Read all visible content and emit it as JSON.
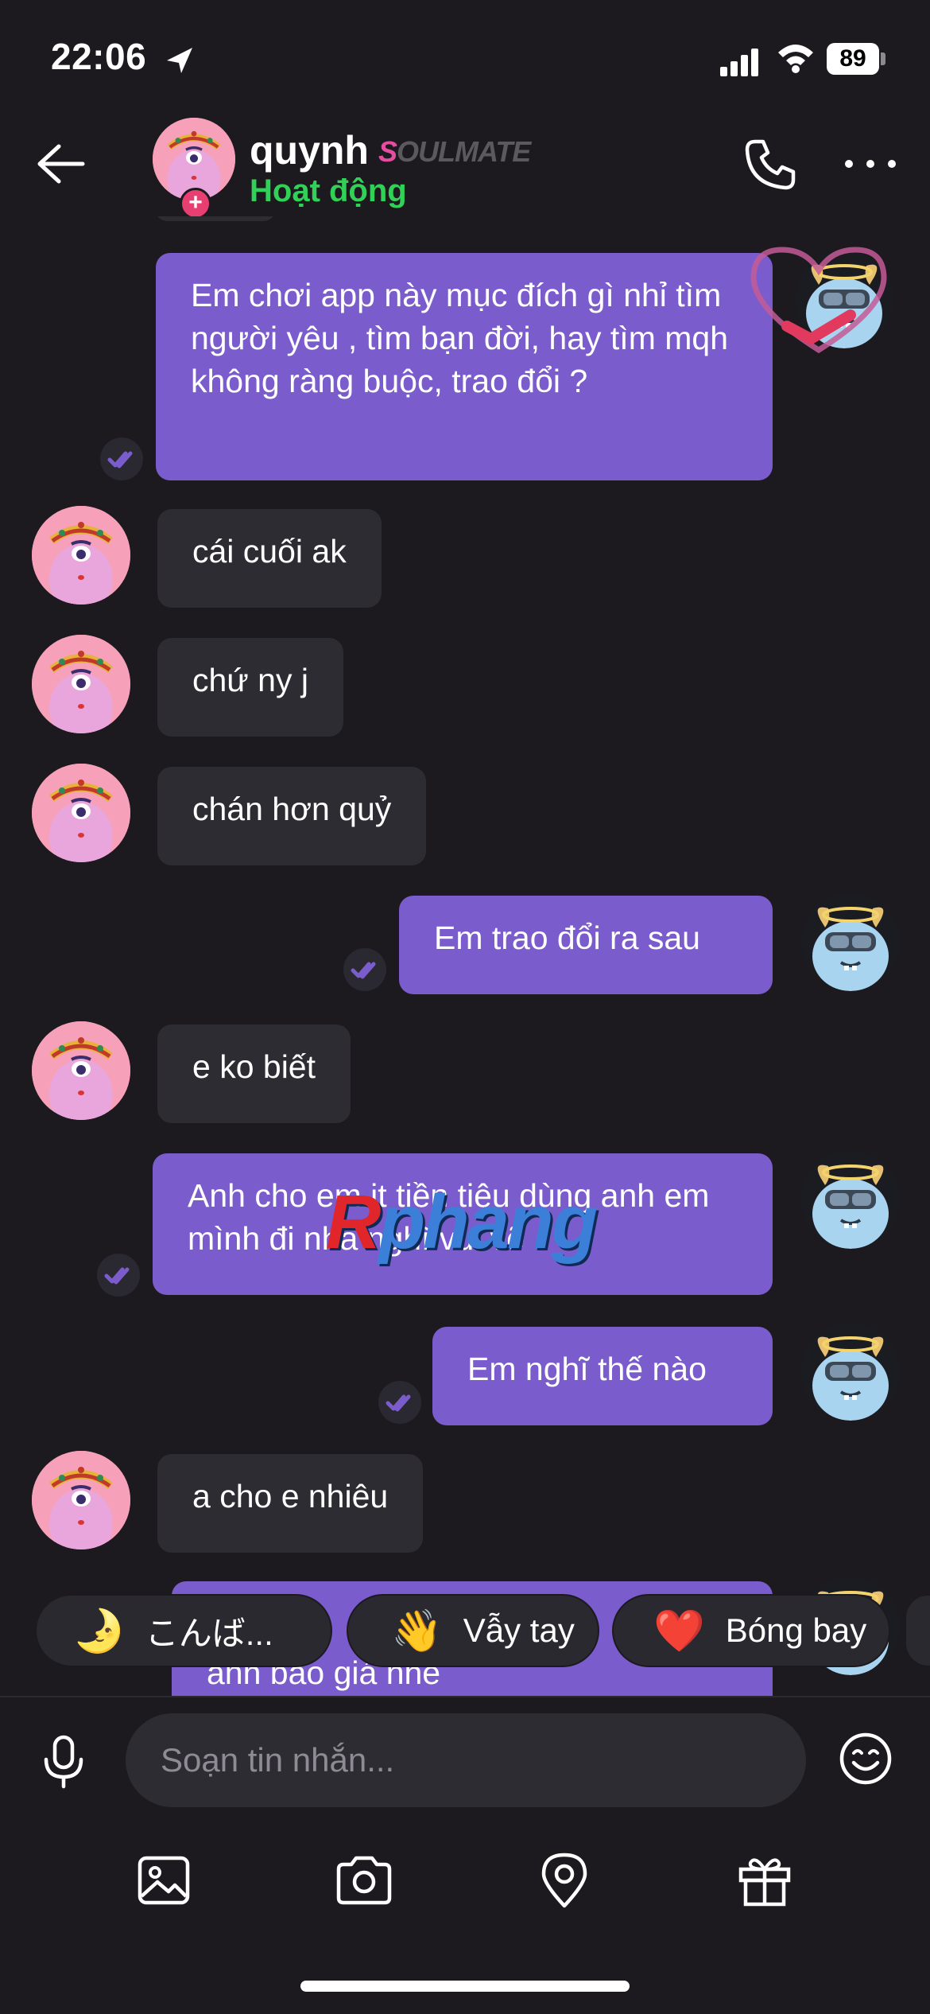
{
  "status_bar": {
    "time": "22:06",
    "battery": "89"
  },
  "header": {
    "name": "quynh",
    "badge": "SOULMATE",
    "status": "Hoạt động"
  },
  "messages": [
    {
      "side": "out",
      "text": "Em chơi app này mục đích gì nhỉ tìm người yêu , tìm bạn đời, hay tìm mqh không ràng buộc, trao đổi ?"
    },
    {
      "side": "in",
      "text": "cái cuối ak"
    },
    {
      "side": "in",
      "text": "chứ ny j"
    },
    {
      "side": "in",
      "text": "chán hơn quỷ"
    },
    {
      "side": "out",
      "text": "Em trao đổi ra sau"
    },
    {
      "side": "in",
      "text": "e ko biết"
    },
    {
      "side": "out",
      "text": "Anh cho em it tiền tiêu dùng anh em mình đi nhà nghĩ vui vẽ"
    },
    {
      "side": "out",
      "text": "Em nghĩ thế nào"
    },
    {
      "side": "in",
      "text": "a cho e nhiêu"
    },
    {
      "side": "out",
      "text": "anh báo giá nhé"
    }
  ],
  "quick_reactions": [
    {
      "emoji": "🌛",
      "label": "こんば..."
    },
    {
      "emoji": "👋",
      "label": "Vẫy tay"
    },
    {
      "emoji": "❤️",
      "label": "Bóng bay"
    }
  ],
  "composer": {
    "placeholder": "Soạn tin nhắn..."
  },
  "watermark": {
    "prefix": "R",
    "rest": "phang"
  },
  "icons": {
    "back": "back-arrow-icon",
    "call": "phone-icon",
    "more": "more-dots-icon",
    "mic": "microphone-icon",
    "emoji": "emoji-icon",
    "image": "image-icon",
    "camera": "camera-icon",
    "location": "location-pin-icon",
    "gift": "gift-icon"
  },
  "colors": {
    "outgoing": "#7b5ccc",
    "incoming": "#2e2c33",
    "online": "#31d158",
    "accent": "#e64da0"
  }
}
